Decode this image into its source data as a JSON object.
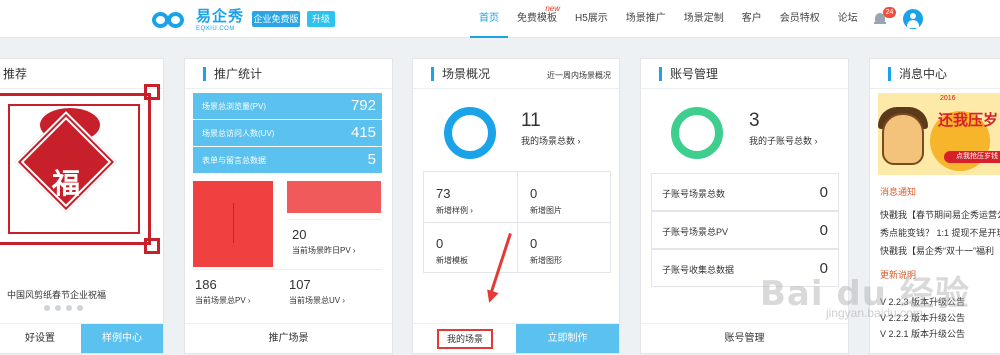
{
  "header": {
    "logo_cn": "易企秀",
    "logo_en": "EQXIU.COM",
    "free_label": "企业免费版",
    "upgrade_label": "升级",
    "nav": [
      {
        "label": "首页"
      },
      {
        "label": "免费模板",
        "badge": "new"
      },
      {
        "label": "H5展示"
      },
      {
        "label": "场景推广"
      },
      {
        "label": "场景定制"
      },
      {
        "label": "客户"
      },
      {
        "label": "会员特权"
      },
      {
        "label": "论坛"
      }
    ],
    "notification_count": "24",
    "accent": "#1aa3e8"
  },
  "recommend": {
    "title": "推荐",
    "papercut_char": "福",
    "caption": "中国风剪纸春节企业祝福",
    "footer_left": "好设置",
    "footer_right": "样例中心"
  },
  "promo": {
    "title": "推广统计",
    "rows": [
      {
        "label": "场景总浏览量(PV)",
        "value": "792"
      },
      {
        "label": "场景总访问人数(UV)",
        "value": "415"
      },
      {
        "label": "表单与留言总数据",
        "value": "5"
      }
    ],
    "yesterday_value": "20",
    "yesterday_label": "当前场景昨日PV",
    "pv_value": "186",
    "pv_label": "当前场景总PV",
    "uv_value": "107",
    "uv_label": "当前场景总UV",
    "footer": "推广场景"
  },
  "scene": {
    "title": "场景概况",
    "subtitle": "近一周内场景概况",
    "total": "11",
    "total_label": "我的场景总数",
    "grid": [
      {
        "value": "73",
        "label": "新增样例"
      },
      {
        "value": "0",
        "label": "新增图片"
      },
      {
        "value": "0",
        "label": "新增模板"
      },
      {
        "value": "0",
        "label": "新增图形"
      }
    ],
    "footer_left": "我的场景",
    "footer_right": "立即制作"
  },
  "account": {
    "title": "账号管理",
    "total": "3",
    "total_label": "我的子账号总数",
    "rows": [
      {
        "label": "子账号场景总数",
        "value": "0"
      },
      {
        "label": "子账号场景总PV",
        "value": "0"
      },
      {
        "label": "子账号收集总数据",
        "value": "0"
      }
    ],
    "footer": "账号管理"
  },
  "messages": {
    "title": "消息中心",
    "banner_text": "还我压岁",
    "banner_top": "2016",
    "banner_badge": "点我抢压岁钱",
    "section1": "消息通知",
    "news": [
      "快戳我【春节期间易企秀运营公",
      "秀点能变钱？ 1:1 提现不是开玩",
      "快戳我【易企秀“双十一”福利"
    ],
    "section2": "更新说明",
    "updates": [
      "V 2.2.3 版本升级公告",
      "V 2.2.2 版本升级公告",
      "V 2.2.1 版本升级公告"
    ]
  },
  "watermark": {
    "main": "Bai du 经验",
    "sub": "jingyan.baidu.com"
  }
}
